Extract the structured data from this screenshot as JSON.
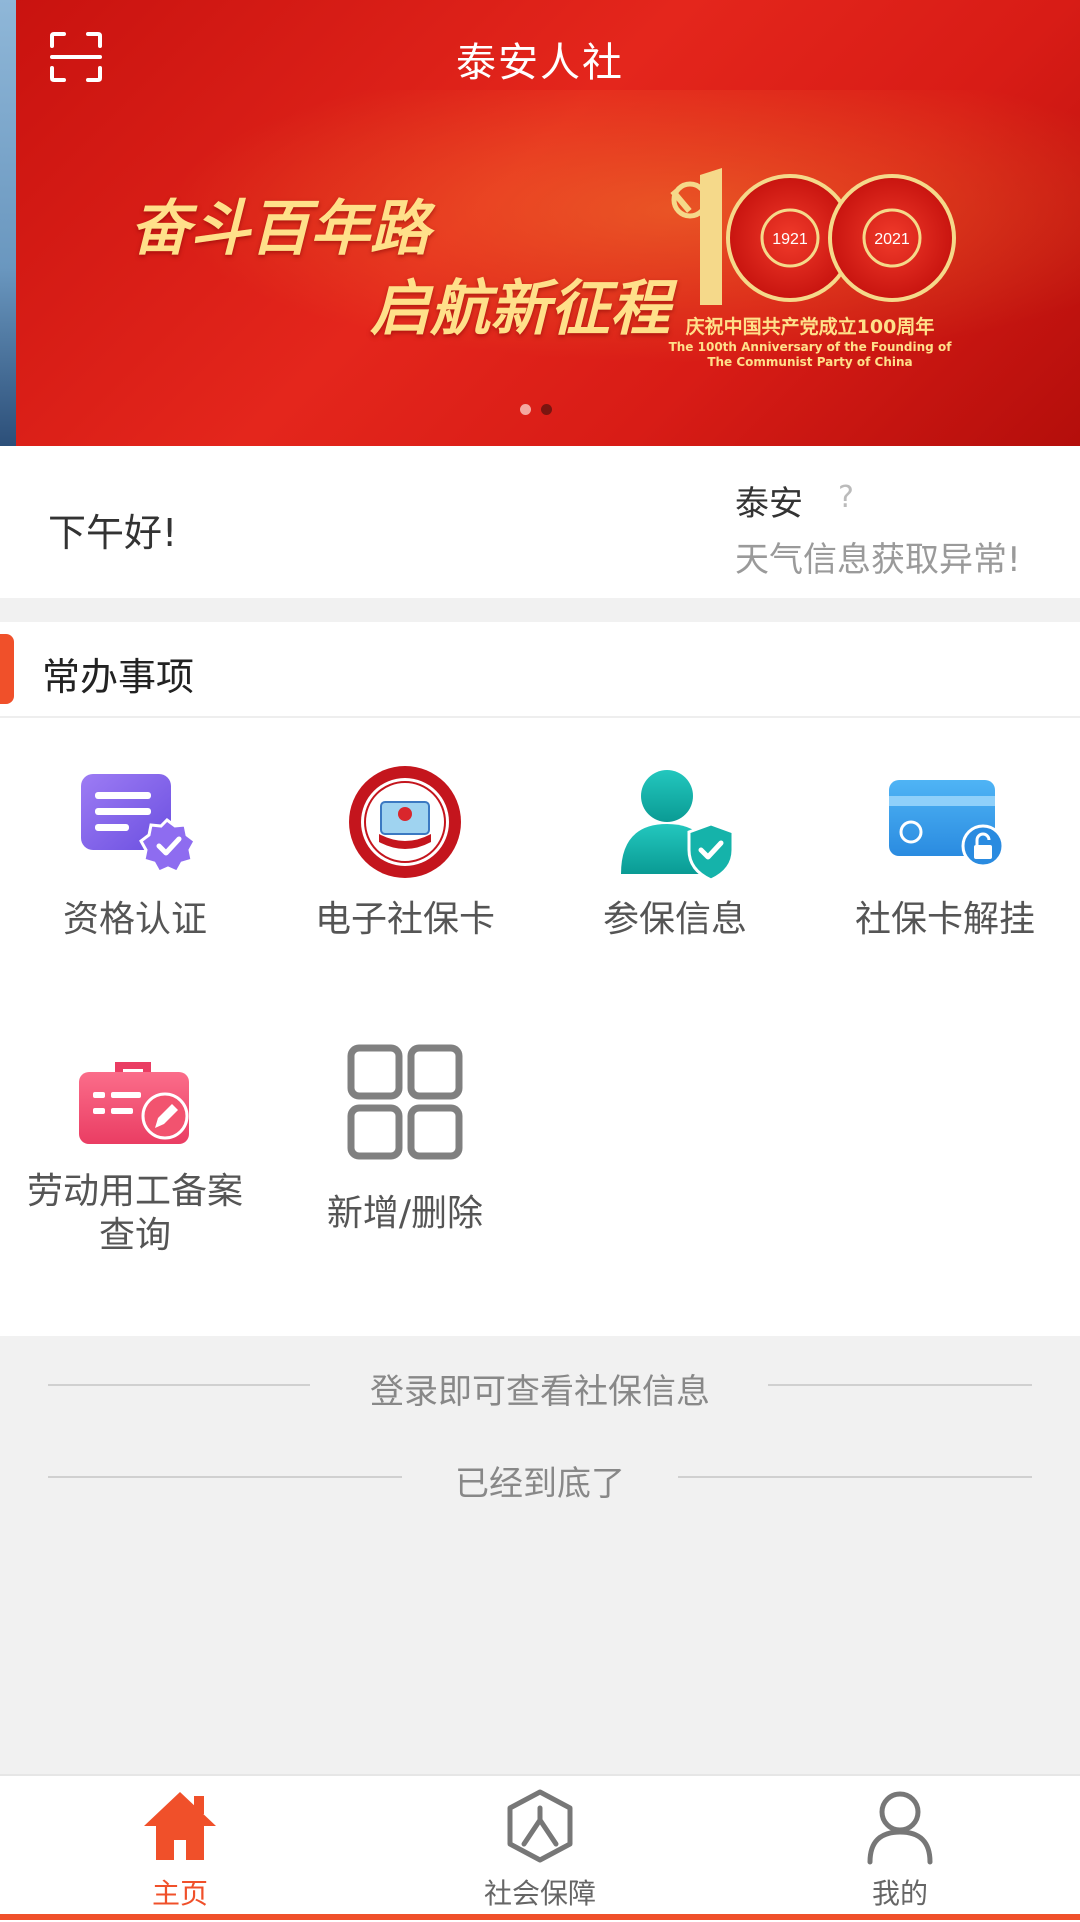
{
  "header": {
    "title": "泰安人社",
    "scan_icon": "scan-icon"
  },
  "banner": {
    "slogan_line1": "奋斗百年路",
    "slogan_line2": "启航新征程",
    "emblem_number": "100",
    "year_start": "1921",
    "year_end": "2021",
    "caption_cn": "庆祝中国共产党成立100周年",
    "caption_en_1": "The 100th Anniversary of the Founding of",
    "caption_en_2": "The Communist Party of China",
    "slide_count": 2,
    "active_slide": 1
  },
  "greeting": {
    "hello": "下午好!",
    "city": "泰安",
    "weather_icon": "question-icon",
    "weather_status": "天气信息获取异常!"
  },
  "services": {
    "title": "常办事项",
    "items": [
      {
        "label": "资格认证",
        "icon": "certificate-check-icon"
      },
      {
        "label": "电子社保卡",
        "icon": "social-security-card-icon"
      },
      {
        "label": "参保信息",
        "icon": "insured-person-icon"
      },
      {
        "label": "社保卡解挂",
        "icon": "card-unlock-icon"
      },
      {
        "label_line1": "劳动用工备案",
        "label_line2": "查询",
        "icon": "briefcase-edit-icon"
      },
      {
        "label": "新增/删除",
        "icon": "grid-add-icon"
      }
    ]
  },
  "notes": {
    "login_hint": "登录即可查看社保信息",
    "end_hint": "已经到底了"
  },
  "tabbar": {
    "tabs": [
      {
        "label": "主页",
        "icon": "home-icon",
        "active": true
      },
      {
        "label": "社会保障",
        "icon": "social-security-icon",
        "active": false
      },
      {
        "label": "我的",
        "icon": "user-icon",
        "active": false
      }
    ]
  },
  "colors": {
    "accent": "#f0502a",
    "banner_red": "#e4261c",
    "gold": "#ffe08a"
  }
}
